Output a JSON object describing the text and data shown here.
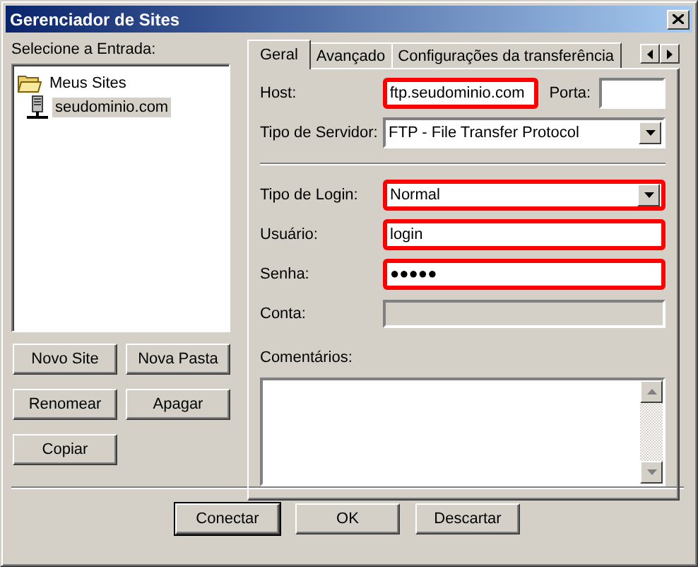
{
  "window": {
    "title": "Gerenciador de Sites"
  },
  "tree": {
    "label": "Selecione a Entrada:",
    "items": [
      {
        "label": "Meus Sites",
        "kind": "folder",
        "selected": false,
        "children": [
          {
            "label": "seudominio.com",
            "kind": "server",
            "selected": true
          }
        ]
      }
    ]
  },
  "tree_buttons": [
    "Novo Site",
    "Nova Pasta",
    "Renomear",
    "Apagar",
    "Copiar"
  ],
  "tabs": [
    {
      "label": "Geral",
      "selected": true
    },
    {
      "label": "Avançado",
      "selected": false
    },
    {
      "label": "Configurações da transferência",
      "selected": false
    }
  ],
  "host": {
    "label": "Host:",
    "value": "ftp.seudominio.com",
    "highlighted": true
  },
  "port": {
    "label": "Porta:"
  },
  "server_type": {
    "label": "Tipo de Servidor:",
    "value": "FTP - File Transfer Protocol",
    "highlighted": false
  },
  "fields": [
    {
      "kind": "dropdown",
      "label": "Tipo de Login:",
      "value": "Normal",
      "highlighted": true,
      "disabled": false
    },
    {
      "kind": "text",
      "label": "Usuário:",
      "value": "login",
      "highlighted": true,
      "disabled": false
    },
    {
      "kind": "password",
      "label": "Senha:",
      "value": "●●●●●",
      "highlighted": true,
      "disabled": false
    },
    {
      "kind": "text",
      "label": "Conta:",
      "highlighted": false,
      "disabled": true
    }
  ],
  "comments": {
    "label": "Comentários:"
  },
  "buttons": [
    {
      "label": "Conectar",
      "default": true
    },
    {
      "label": "OK",
      "default": false
    },
    {
      "label": "Descartar",
      "default": false
    }
  ]
}
